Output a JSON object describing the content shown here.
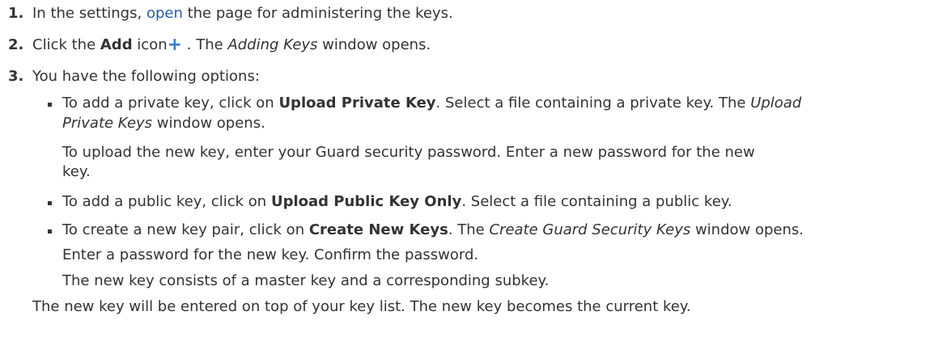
{
  "steps": [
    {
      "number": "1.",
      "text_before": "In the settings, ",
      "link": "open",
      "text_after": " the page for administering the keys."
    },
    {
      "number": "2.",
      "text_before": "Click the ",
      "bold": "Add",
      "text_mid": " icon",
      "icon": "+",
      "text_after": " . The ",
      "italic": "Adding Keys",
      "text_end": " window opens."
    },
    {
      "number": "3.",
      "text": "You have the following options:"
    }
  ],
  "options": [
    {
      "line1_before": "To add a private key, click on ",
      "line1_bold": "Upload Private Key",
      "line1_after": ". Select a file containing a private key. The ",
      "line1_italic": "Upload",
      "line2_italic": "Private Keys",
      "line2_after": " window opens.",
      "para_line1": "To upload the new key, enter your Guard security password. Enter a new password for the new",
      "para_line2": "key."
    },
    {
      "line1_before": "To add a public key, click on ",
      "line1_bold": "Upload Public Key Only",
      "line1_after": ". Select a file containing a public key."
    },
    {
      "line1_before": "To create a new key pair, click on ",
      "line1_bold": "Create New Keys",
      "line1_after": ". The ",
      "line1_italic": "Create Guard Security Keys",
      "line1_end": " window opens.",
      "para_line1": "Enter a password for the new key. Confirm the password.",
      "para_line2": "The new key consists of a master key and a corresponding subkey."
    }
  ],
  "result": "The new key will be entered on top of your key list. The new key becomes the current key.",
  "colors": {
    "link": "#2b5ca8",
    "icon": "#3a7dc9",
    "text": "#333333"
  }
}
